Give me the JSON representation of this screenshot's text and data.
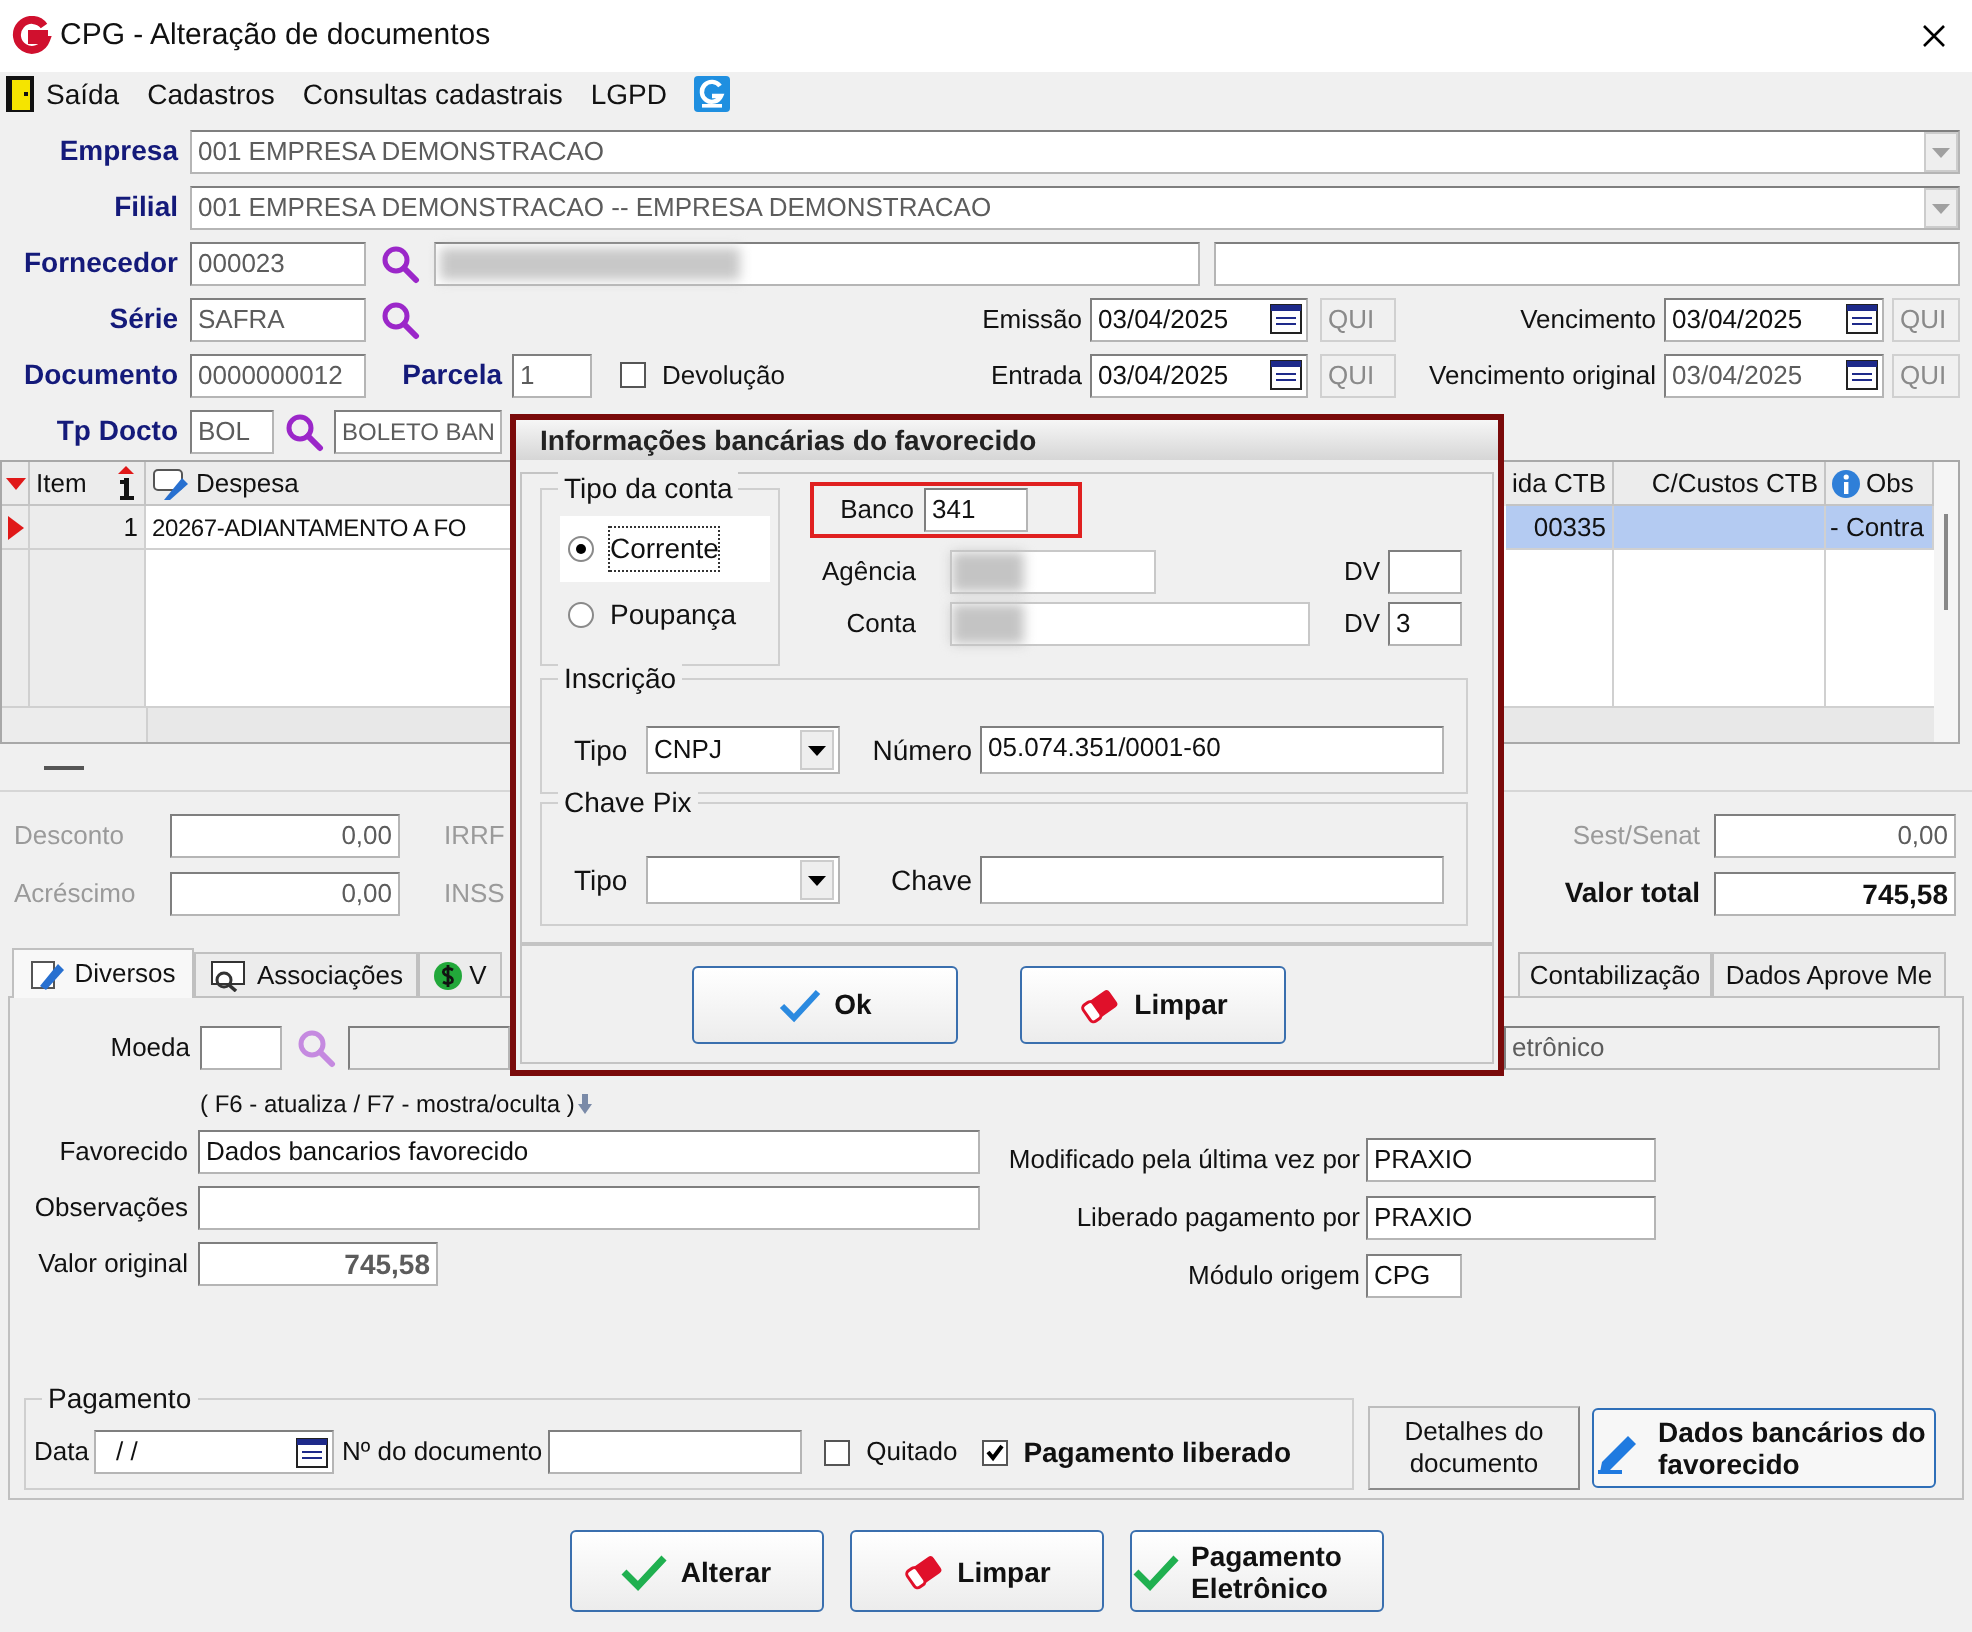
{
  "window": {
    "title": "CPG - Alteração de documentos"
  },
  "menu": [
    {
      "label": "Saída"
    },
    {
      "label": "Cadastros"
    },
    {
      "label": "Consultas cadastrais"
    },
    {
      "label": "LGPD"
    }
  ],
  "header": {
    "empresa": {
      "label": "Empresa",
      "value": "001 EMPRESA DEMONSTRACAO",
      "disabled": true
    },
    "filial": {
      "label": "Filial",
      "value": "001 EMPRESA DEMONSTRACAO -- EMPRESA DEMONSTRACAO",
      "disabled": true
    },
    "fornecedor": {
      "label": "Fornecedor",
      "value": "000023",
      "disabled": true,
      "name_redacted": true
    },
    "serie": {
      "label": "Série",
      "value": "SAFRA",
      "disabled": true
    },
    "documento": {
      "label": "Documento",
      "value": "0000000012",
      "disabled": true
    },
    "parcela": {
      "label": "Parcela",
      "value": "1",
      "disabled": true
    },
    "devolucao": {
      "label": "Devolução",
      "checked": false
    },
    "tp_docto": {
      "label": "Tp Docto",
      "value": "BOL",
      "description": "BOLETO BAN",
      "disabled": true
    },
    "dates": [
      {
        "label": "Emissão",
        "value": "03/04/2025",
        "weekday": "QUI",
        "disabled": false
      },
      {
        "label": "Vencimento",
        "value": "03/04/2025",
        "weekday": "QUI",
        "disabled": false
      },
      {
        "label": "Entrada",
        "value": "03/04/2025",
        "weekday": "QUI",
        "disabled": false
      },
      {
        "label": "Vencimento original",
        "value": "03/04/2025",
        "weekday": "QUI",
        "disabled": true
      }
    ]
  },
  "grid": {
    "columns": [
      {
        "label": "Item"
      },
      {
        "label": "Despesa"
      },
      {
        "label": "ida CTB"
      },
      {
        "label": "C/Custos CTB"
      },
      {
        "label": "Obs"
      }
    ],
    "rows": [
      {
        "item": "1",
        "despesa": "20267-ADIANTAMENTO A FO",
        "column_3": "00335",
        "obs": "- Contra",
        "selected": true
      }
    ]
  },
  "totals": [
    {
      "label": "Desconto",
      "value": "0,00",
      "tax": "IRRF"
    },
    {
      "label": "Acréscimo",
      "value": "0,00",
      "tax": "INSS"
    }
  ],
  "right_totals": [
    {
      "label": "Sest/Senat",
      "value": "0,00",
      "kind": "normal"
    },
    {
      "label": "Valor total",
      "value": "745,58",
      "kind": "total"
    }
  ],
  "tabs": [
    {
      "label": "Diversos",
      "selected": true
    },
    {
      "label": "Associações",
      "selected": false
    },
    {
      "label": "V",
      "selected": false
    },
    {
      "label": "Contabilização",
      "selected": false
    },
    {
      "label": "Dados Aprove Me",
      "selected": false
    }
  ],
  "diversos": {
    "moeda": {
      "label": "Moeda"
    },
    "moeda_description": "etrônico",
    "hint": "( F6 - atualiza / F7 - mostra/oculta )",
    "favorecido": {
      "label": "Favorecido",
      "value": "Dados bancarios favorecido"
    },
    "observacoes": {
      "label": "Observações"
    },
    "valor_original": {
      "label": "Valor original",
      "value": "745,58"
    },
    "modificado": {
      "label": "Modificado pela última vez por",
      "value": "PRAXIO"
    },
    "liberado_por": {
      "label": "Liberado pagamento por",
      "value": "PRAXIO"
    },
    "modulo": {
      "label": "Módulo origem",
      "value": "CPG"
    }
  },
  "pagamento": {
    "legend": "Pagamento",
    "data": {
      "label": "Data",
      "value": "/ /"
    },
    "numero": {
      "label": "Nº do documento"
    },
    "quitado": {
      "label": "Quitado",
      "checked": false
    },
    "liberado": {
      "label": "Pagamento liberado",
      "checked": true
    }
  },
  "side_buttons": [
    {
      "label": "Detalhes do documento",
      "kind": "plain"
    },
    {
      "label": "Dados bancários do favorecido",
      "kind": "edit"
    }
  ],
  "footer_buttons": [
    {
      "label": "Alterar",
      "kind": "confirm"
    },
    {
      "label": "Limpar",
      "kind": "clear"
    },
    {
      "label": "Pagamento Eletrônico",
      "kind": "confirm"
    }
  ],
  "dialog": {
    "title": "Informações bancárias do favorecido",
    "tipo_conta": {
      "legend": "Tipo da conta",
      "options": [
        {
          "label": "Corrente",
          "selected": true
        },
        {
          "label": "Poupança",
          "selected": false
        }
      ]
    },
    "banco": {
      "label": "Banco",
      "value": "341",
      "highlighted": true
    },
    "agencia": {
      "label": "Agência",
      "redacted": true,
      "dv_label": "DV"
    },
    "conta": {
      "label": "Conta",
      "redacted": true,
      "dv_label": "DV",
      "dv": "3"
    },
    "inscricao": {
      "legend": "Inscrição",
      "tipo_label": "Tipo",
      "tipo": "CNPJ",
      "numero_label": "Número",
      "numero": "05.074.351/0001-60"
    },
    "chave_pix": {
      "legend": "Chave Pix",
      "tipo_label": "Tipo",
      "chave_label": "Chave"
    },
    "buttons": [
      {
        "label": "Ok",
        "kind": "ok"
      },
      {
        "label": "Limpar",
        "kind": "clear"
      }
    ]
  }
}
